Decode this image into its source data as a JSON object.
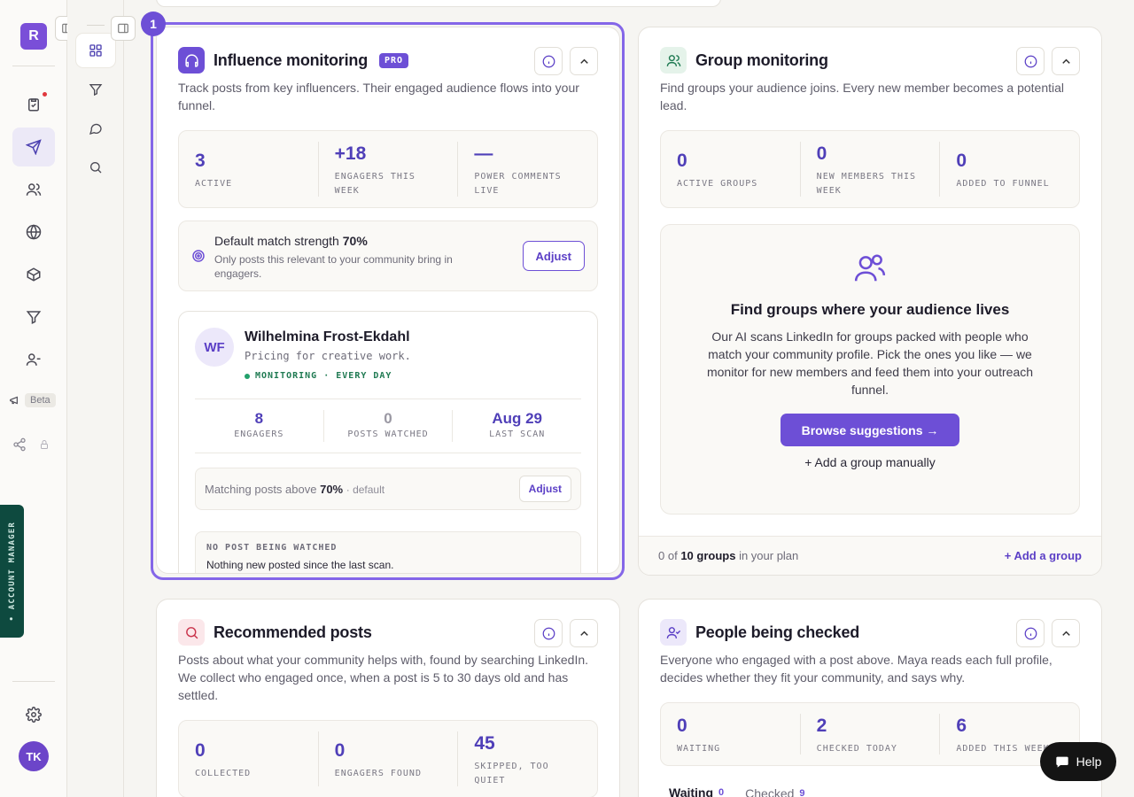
{
  "brand": {
    "logo_letter": "R"
  },
  "rail": {
    "beta_label": "Beta",
    "avatar_initials": "TK",
    "account_manager_label": "• ACCOUNT MANAGER"
  },
  "step": {
    "number": "1"
  },
  "influence": {
    "title": "Influence monitoring",
    "badge": "PRO",
    "description": "Track posts from key influencers. Their engaged audience flows into your funnel.",
    "stats": [
      {
        "value": "3",
        "label": "ACTIVE"
      },
      {
        "value": "+18",
        "label": "ENGAGERS THIS WEEK"
      },
      {
        "value": "—",
        "label": "POWER COMMENTS LIVE"
      }
    ],
    "match": {
      "title_prefix": "Default match strength",
      "title_value": "70%",
      "subtitle": "Only posts this relevant to your community bring in engagers.",
      "adjust_label": "Adjust"
    },
    "influencer": {
      "initials": "WF",
      "name": "Wilhelmina Frost-Ekdahl",
      "tagline": "Pricing for creative work.",
      "status": "MONITORING · EVERY DAY",
      "stats": [
        {
          "value": "8",
          "label": "ENGAGERS"
        },
        {
          "value": "0",
          "label": "POSTS WATCHED"
        },
        {
          "value": "Aug 29",
          "label": "LAST SCAN"
        }
      ],
      "match_prefix": "Matching posts above",
      "match_value": "70%",
      "match_suffix": "· default",
      "adjust_label": "Adjust",
      "nopost_heading": "NO POST BEING WATCHED",
      "nopost_text": "Nothing new posted since the last scan."
    }
  },
  "group": {
    "title": "Group monitoring",
    "description": "Find groups your audience joins. Every new member becomes a potential lead.",
    "stats": [
      {
        "value": "0",
        "label": "ACTIVE GROUPS"
      },
      {
        "value": "0",
        "label": "NEW MEMBERS THIS WEEK"
      },
      {
        "value": "0",
        "label": "ADDED TO FUNNEL"
      }
    ],
    "empty_title": "Find groups where your audience lives",
    "empty_desc": "Our AI scans LinkedIn for groups packed with people who match your community profile. Pick the ones you like — we monitor for new members and feed them into your outreach funnel.",
    "browse_label": "Browse suggestions →",
    "add_manual_label": "+ Add a group manually",
    "footer_prefix": "0 of",
    "footer_bold": "10 groups",
    "footer_suffix": "in your plan",
    "footer_add": "+ Add a group"
  },
  "recommended": {
    "title": "Recommended posts",
    "description": "Posts about what your community helps with, found by searching LinkedIn. We collect who engaged once, when a post is 5 to 30 days old and has settled.",
    "stats": [
      {
        "value": "0",
        "label": "COLLECTED"
      },
      {
        "value": "0",
        "label": "ENGAGERS FOUND"
      },
      {
        "value": "45",
        "label": "SKIPPED, TOO QUIET"
      }
    ]
  },
  "people": {
    "title": "People being checked",
    "description": "Everyone who engaged with a post above. Maya reads each full profile, decides whether they fit your community, and says why.",
    "stats": [
      {
        "value": "0",
        "label": "WAITING"
      },
      {
        "value": "2",
        "label": "CHECKED TODAY"
      },
      {
        "value": "6",
        "label": "ADDED THIS WEEK"
      }
    ],
    "tabs": [
      {
        "label": "Waiting",
        "count": "0"
      },
      {
        "label": "Checked",
        "count": "9"
      }
    ]
  },
  "help": {
    "label": "Help"
  }
}
